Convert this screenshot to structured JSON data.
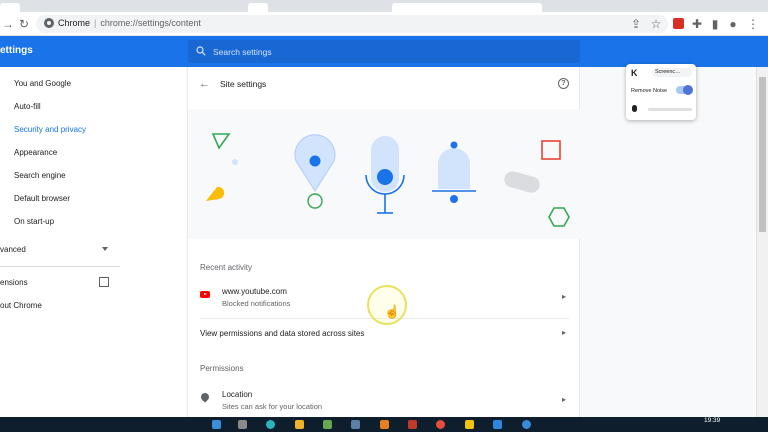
{
  "browser": {
    "site_name": "Chrome",
    "url_path": "chrome://settings/content"
  },
  "header": {
    "title": "ettings",
    "search_placeholder": "Search settings"
  },
  "sidebar": {
    "items": [
      {
        "label": "You and Google"
      },
      {
        "label": "Auto-fill"
      },
      {
        "label": "Security and privacy"
      },
      {
        "label": "Appearance"
      },
      {
        "label": "Search engine"
      },
      {
        "label": "Default browser"
      },
      {
        "label": "On start-up"
      }
    ],
    "advanced_label": "vanced",
    "extensions_label": "ensions",
    "about_label": "out Chrome"
  },
  "content": {
    "page_title": "Site settings",
    "recent_activity_title": "Recent activity",
    "recent_site": "www.youtube.com",
    "recent_site_status": "Blocked notifications",
    "view_permissions_label": "View permissions and data stored across sites",
    "permissions_title": "Permissions",
    "location_title": "Location",
    "location_sub": "Sites can ask for your location"
  },
  "widget": {
    "logo": "K",
    "screen_button": "Screenc…",
    "remove_noise_label": "Remove Noise"
  },
  "taskbar": {
    "time": "19:39"
  },
  "colors": {
    "accent": "#1a73e8",
    "header": "#1a73e8"
  }
}
